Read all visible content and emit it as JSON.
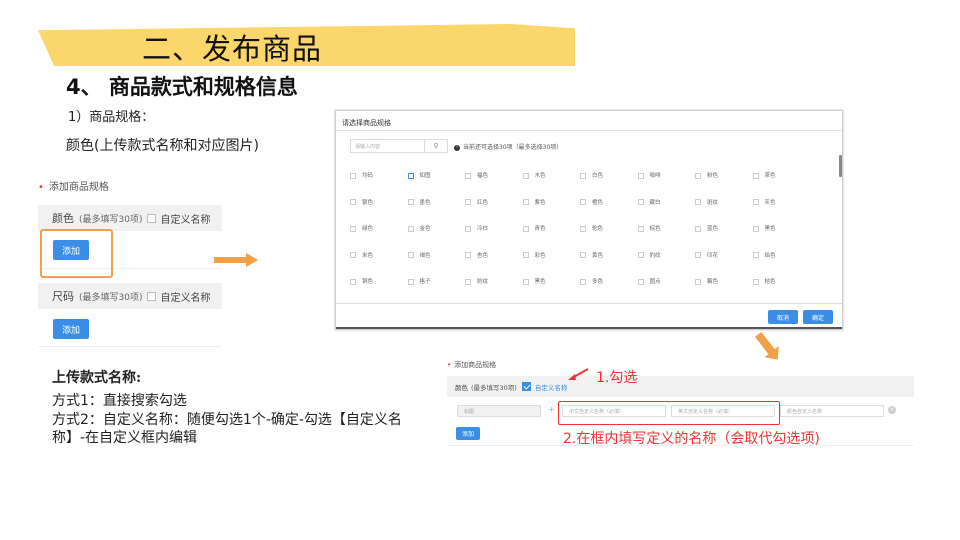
{
  "banner": {
    "title": "二、发布商品"
  },
  "section": {
    "title": "4、 商品款式和规格信息",
    "subtitle": "1）商品规格：",
    "color_desc": "颜色(上传款式名称和对应图片)"
  },
  "left_panel": {
    "header": "添加商品规格",
    "header_dot": "•",
    "groups": [
      {
        "name": "颜色",
        "hint": "(最多填写30项)",
        "custom_label": "自定义名称",
        "add_label": "添加"
      },
      {
        "name": "尺码",
        "hint": "(最多填写30项)",
        "custom_label": "自定义名称",
        "add_label": "添加"
      }
    ]
  },
  "dialog": {
    "title": "请选择商品规格",
    "search_placeholder": "请输入内容",
    "search_icon": "⚲",
    "info_icon": "!",
    "info": "当前还可选择30项（最多选择30项）",
    "rows": [
      [
        "均码",
        "如图",
        "福色",
        "木色",
        "白色",
        "咖啡",
        "粉色",
        "茶色"
      ],
      [
        "银色",
        "墨色",
        "红色",
        "紫色",
        "橙色",
        "藏白",
        "斑纹",
        "灰色"
      ],
      [
        "绿色",
        "金色",
        "冷白",
        "青色",
        "驼色",
        "棕色",
        "蓝色",
        "黑色"
      ],
      [
        "米色",
        "褐色",
        "杏色",
        "彩色",
        "黄色",
        "豹纹",
        "印花",
        "焰色"
      ],
      [
        "铜色",
        "格子",
        "豹纹",
        "黑色",
        "多色",
        "圆点",
        "藕色",
        "桔色"
      ]
    ],
    "cancel_label": "取消",
    "confirm_label": "确定"
  },
  "right_panel": {
    "header": "添加商品规格",
    "header_dot": "•",
    "group_name": "颜色",
    "hint": "(最多填写30项)",
    "custom_label": "自定义名称",
    "custom_checked": true,
    "input_selected": "如图",
    "input_cn_placeholder": "中文自定义名称（必填）",
    "input_en_placeholder": "英文自定义名称（必填）",
    "input_price_placeholder": "颜色自定义名称",
    "add_label": "添加",
    "plus": "+",
    "clear": "×"
  },
  "annotations": {
    "step1": "1.勾选",
    "step2": "2.在框内填写定义的名称（会取代勾选项)"
  },
  "instructions": {
    "title": "上传款式名称:",
    "method1": "方式1：直接搜索勾选",
    "method2": "方式2：自定义名称：随便勾选1个-确定-勾选【自定义名称】-在自定义框内编辑"
  },
  "colors": {
    "banner": "#FBD66A",
    "accent_blue": "#3a8ee6",
    "highlight_orange": "#f0a047",
    "annotation_red": "#e33333"
  }
}
